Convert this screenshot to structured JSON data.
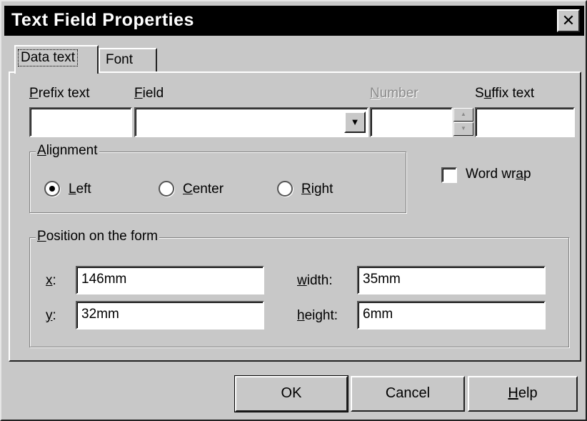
{
  "window": {
    "title": "Text Field Properties",
    "close_glyph": "✕"
  },
  "tabs": [
    {
      "label": "Data text",
      "active": true
    },
    {
      "label": "Font",
      "active": false
    }
  ],
  "fields": {
    "prefix": {
      "label_pre": "",
      "label_ul": "P",
      "label_post": "refix text",
      "value": ""
    },
    "field": {
      "label_pre": "",
      "label_ul": "F",
      "label_post": "ield",
      "value": "",
      "icon": "dropdown-arrow-icon"
    },
    "number": {
      "label_pre": "",
      "label_ul": "N",
      "label_post": "umber",
      "value": "",
      "enabled": false
    },
    "suffix": {
      "label_pre": "S",
      "label_ul": "u",
      "label_post": "ffix text",
      "value": ""
    }
  },
  "alignment": {
    "title_pre": "",
    "title_ul": "A",
    "title_post": "lignment",
    "options": [
      {
        "label_pre": "",
        "label_ul": "L",
        "label_post": "eft",
        "selected": true
      },
      {
        "label_pre": "",
        "label_ul": "C",
        "label_post": "enter",
        "selected": false
      },
      {
        "label_pre": "",
        "label_ul": "R",
        "label_post": "ight",
        "selected": false
      }
    ]
  },
  "word_wrap": {
    "label_pre": "Word wr",
    "label_ul": "a",
    "label_post": "p",
    "checked": false
  },
  "position": {
    "title_pre": "",
    "title_ul": "P",
    "title_post": "osition on the form",
    "x": {
      "label_ul": "x",
      "label_post": ":",
      "value": "146mm"
    },
    "y": {
      "label_ul": "y",
      "label_post": ":",
      "value": "32mm"
    },
    "width": {
      "label_ul": "w",
      "label_post": "idth:",
      "value": "35mm"
    },
    "height": {
      "label_ul": "h",
      "label_post": "eight:",
      "value": "6mm"
    }
  },
  "buttons": {
    "ok": {
      "label": "OK"
    },
    "cancel": {
      "label": "Cancel"
    },
    "help": {
      "label_ul": "H",
      "label_post": "elp"
    }
  }
}
